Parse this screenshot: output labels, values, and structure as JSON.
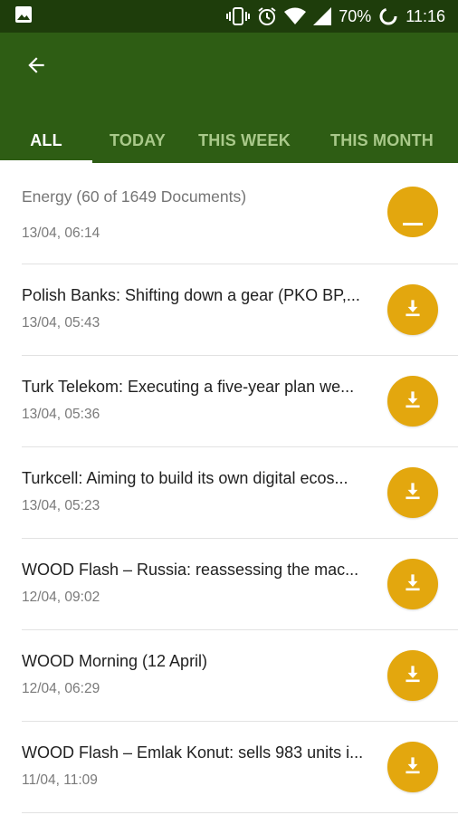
{
  "status_bar": {
    "battery": "70%",
    "time": "11:16",
    "icons": [
      "image-icon",
      "vibrate-icon",
      "alarm-icon",
      "wifi-icon",
      "signal-icon",
      "battery-icon"
    ]
  },
  "app_bar": {
    "back_icon": "arrow-back-icon",
    "tabs": [
      {
        "label": "ALL",
        "active": true
      },
      {
        "label": "TODAY",
        "active": false
      },
      {
        "label": "THIS WEEK",
        "active": false
      },
      {
        "label": "THIS MONTH",
        "active": false
      }
    ]
  },
  "colors": {
    "status_bar": "#1e3d0b",
    "app_bar": "#2e5d14",
    "accent": "#e3a70e",
    "tab_inactive": "#a9c98a"
  },
  "list": {
    "header": "Energy (60 of 1649 Documents)",
    "partial_item": {
      "date": "13/04, 06:14"
    },
    "items": [
      {
        "title": "Polish Banks: Shifting down a gear (PKO BP,...",
        "date": "13/04, 05:43"
      },
      {
        "title": "Turk Telekom: Executing a five-year plan we...",
        "date": "13/04, 05:36"
      },
      {
        "title": "Turkcell: Aiming to build its own digital ecos...",
        "date": "13/04, 05:23"
      },
      {
        "title": "WOOD Flash – Russia: reassessing the mac...",
        "date": "12/04, 09:02"
      },
      {
        "title": "WOOD Morning (12 April)",
        "date": "12/04, 06:29"
      },
      {
        "title": "WOOD Flash – Emlak Konut: sells 983 units i...",
        "date": "11/04, 11:09"
      }
    ],
    "download_icon": "download-icon"
  }
}
